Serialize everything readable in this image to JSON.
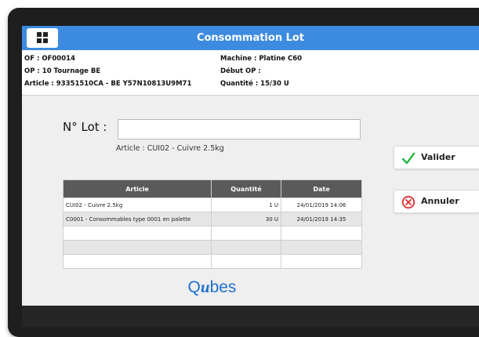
{
  "header": {
    "title": "Consommation Lot",
    "menu_icon": "grid-icon"
  },
  "info": {
    "of": "OF : OF00014",
    "op": "OP : 10 Tournage BE",
    "article": "Article : 93351510CA - BE Y57N10813U9M71",
    "machine": "Machine : Platine C60",
    "debut_op": "Début OP :",
    "quantite": "Quantité : 15/30 U"
  },
  "form": {
    "lot_label": "N° Lot :",
    "lot_value": "",
    "article_info": "Article : CUI02 - Cuivre 2.5kg"
  },
  "table": {
    "headers": {
      "article": "Article",
      "quantite": "Quantité",
      "date": "Date"
    },
    "rows": [
      {
        "article": "CUI02 - Cuivre 2.5kg",
        "quantite": "1  U",
        "date": "24/01/2019 14:06"
      },
      {
        "article": "C0001 - Consommables type 0001 en palette",
        "quantite": "30  U",
        "date": "24/01/2019 14:35"
      },
      {
        "article": "",
        "quantite": "",
        "date": ""
      },
      {
        "article": "",
        "quantite": "",
        "date": ""
      },
      {
        "article": "",
        "quantite": "",
        "date": ""
      }
    ]
  },
  "actions": {
    "valider": {
      "label": "Valider",
      "icon": "check-icon",
      "color": "#2fb84a"
    },
    "annuler": {
      "label": "Annuler",
      "icon": "cancel-circle-icon",
      "color": "#e03030"
    }
  },
  "logo": {
    "prefix": "Q",
    "accent": "u",
    "suffix": "bes",
    "color": "#1f6fd0"
  },
  "colors": {
    "titlebar": "#3d8be0",
    "table_header": "#5a5a5a",
    "content_bg": "#efefef"
  }
}
